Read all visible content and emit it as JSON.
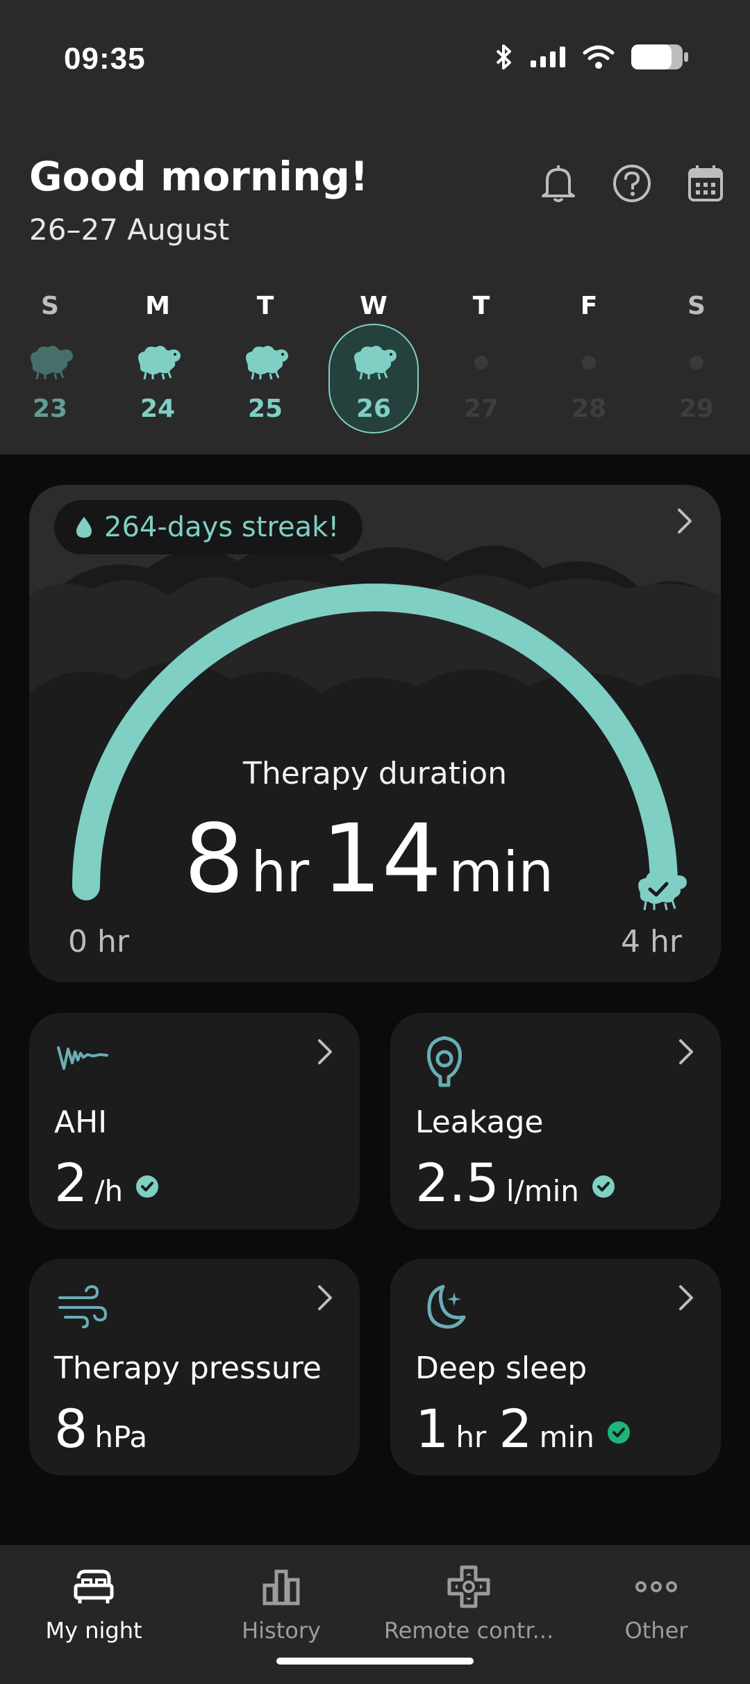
{
  "status": {
    "time": "09:35"
  },
  "header": {
    "greeting": "Good morning!",
    "date_range": "26–27 August",
    "actions": [
      "bell-icon",
      "help-icon",
      "calendar-icon"
    ]
  },
  "week": [
    {
      "letter": "S",
      "num": "23",
      "state": "past"
    },
    {
      "letter": "M",
      "num": "24",
      "state": "past"
    },
    {
      "letter": "T",
      "num": "25",
      "state": "past"
    },
    {
      "letter": "W",
      "num": "26",
      "state": "selected"
    },
    {
      "letter": "T",
      "num": "27",
      "state": "future"
    },
    {
      "letter": "F",
      "num": "28",
      "state": "future"
    },
    {
      "letter": "S",
      "num": "29",
      "state": "future"
    }
  ],
  "therapy": {
    "streak": "264-days streak!",
    "title": "Therapy duration",
    "hours": "8",
    "hours_unit": "hr",
    "minutes": "14",
    "minutes_unit": "min",
    "min_label": "0 hr",
    "max_label": "4 hr",
    "goal_progress": 1.0
  },
  "metrics": [
    {
      "label": "AHI",
      "value": "2",
      "unit": "/h",
      "ok": true
    },
    {
      "label": "Leakage",
      "value": "2.5",
      "unit": "l/min",
      "ok": true
    },
    {
      "label": "Therapy pressure",
      "value": "8",
      "unit": "hPa",
      "ok": false
    },
    {
      "label": "Deep sleep",
      "value1": "1",
      "unit1": "hr",
      "value2": "2",
      "unit2": "min",
      "ok": true
    }
  ],
  "tabs": [
    {
      "label": "My night",
      "icon": "bed-icon",
      "active": true
    },
    {
      "label": "History",
      "icon": "bar-chart-icon",
      "active": false
    },
    {
      "label": "Remote contr...",
      "icon": "remote-icon",
      "active": false
    },
    {
      "label": "Other",
      "icon": "more-icon",
      "active": false
    }
  ],
  "colors": {
    "accent": "#7fcfc4",
    "ok_green": "#1fb57a",
    "background": "#0b0b0b",
    "header": "#2a2a2a"
  }
}
